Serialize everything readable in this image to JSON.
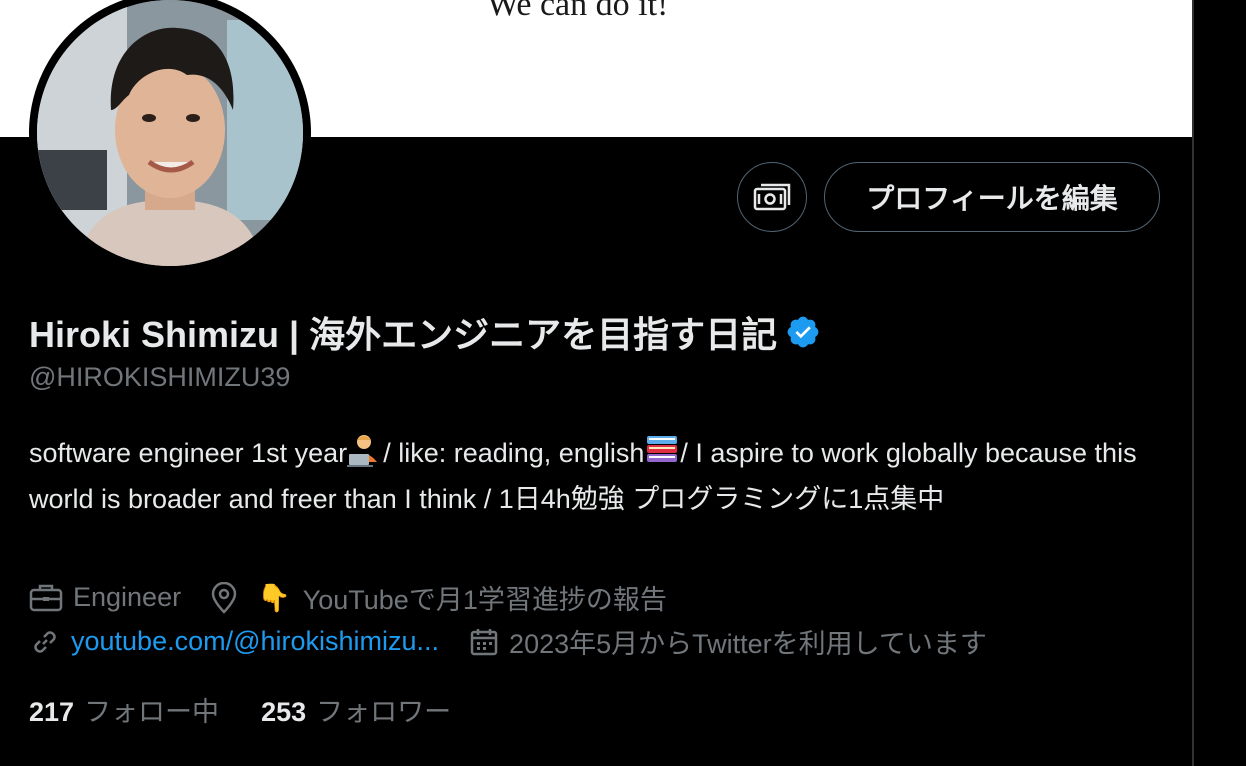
{
  "banner": {
    "text": "We can do it!"
  },
  "buttons": {
    "icon_button": "money-settings-icon",
    "edit_profile_label": "プロフィールを編集"
  },
  "profile": {
    "display_name": "Hiroki Shimizu | 海外エンジニアを目指す日記",
    "verified_icon": "verified-badge-icon",
    "handle": "@HIROKISHIMIZU39",
    "bio_parts": [
      "software engineer 1st year",
      "/ like: reading, english",
      "/ I aspire to work globally because this world is broader and freer than I think / 1日4h勉強 プログラミングに1点集中"
    ],
    "job": "Engineer",
    "location_emoji": "👇",
    "location": "YouTubeで月1学習進捗の報告",
    "website": "youtube.com/@hirokishimizu...",
    "joined": "2023年5月からTwitterを利用しています"
  },
  "stats": {
    "following_count": "217",
    "following_label": "フォロー中",
    "followers_count": "253",
    "followers_label": "フォロワー"
  },
  "colors": {
    "background": "#000000",
    "text_primary": "#e7e9ea",
    "text_secondary": "#71767b",
    "link": "#1d9bf0",
    "verified": "#1d9bf0",
    "button_border": "#536471"
  }
}
